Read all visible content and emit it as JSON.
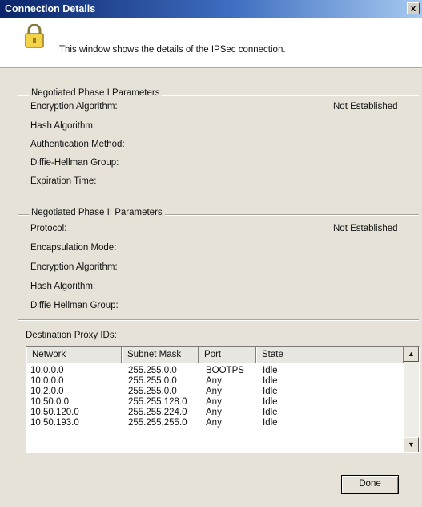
{
  "window": {
    "title": "Connection Details",
    "close_label": "x"
  },
  "header": {
    "text": "This window shows the details of the IPSec connection."
  },
  "phase1": {
    "legend": "Negotiated Phase I Parameters",
    "status": "Not Established",
    "fields": [
      "Encryption Algorithm:",
      "Hash Algorithm:",
      "Authentication Method:",
      "Diffie-Hellman Group:",
      "Expiration Time:"
    ]
  },
  "phase2": {
    "legend": "Negotiated Phase II Parameters",
    "status": "Not Established",
    "fields": [
      "Protocol:",
      "Encapsulation Mode:",
      "Encryption Algorithm:",
      "Hash Algorithm:",
      "Diffie Hellman Group:"
    ]
  },
  "proxy": {
    "label": "Destination Proxy IDs:",
    "columns": [
      "Network",
      "Subnet Mask",
      "Port",
      "State"
    ],
    "rows": [
      [
        "10.0.0.0",
        "255.255.0.0",
        "BOOTPS",
        "Idle"
      ],
      [
        "10.0.0.0",
        "255.255.0.0",
        "Any",
        "Idle"
      ],
      [
        "10.2.0.0",
        "255.255.0.0",
        "Any",
        "Idle"
      ],
      [
        "10.50.0.0",
        "255.255.128.0",
        "Any",
        "Idle"
      ],
      [
        "10.50.120.0",
        "255.255.224.0",
        "Any",
        "Idle"
      ],
      [
        "10.50.193.0",
        "255.255.255.0",
        "Any",
        "Idle"
      ]
    ]
  },
  "done_label": "Done",
  "icons": {
    "lock": "lock-icon",
    "close": "close-icon",
    "scroll_up": "scroll-up-icon",
    "scroll_down": "scroll-down-icon"
  }
}
